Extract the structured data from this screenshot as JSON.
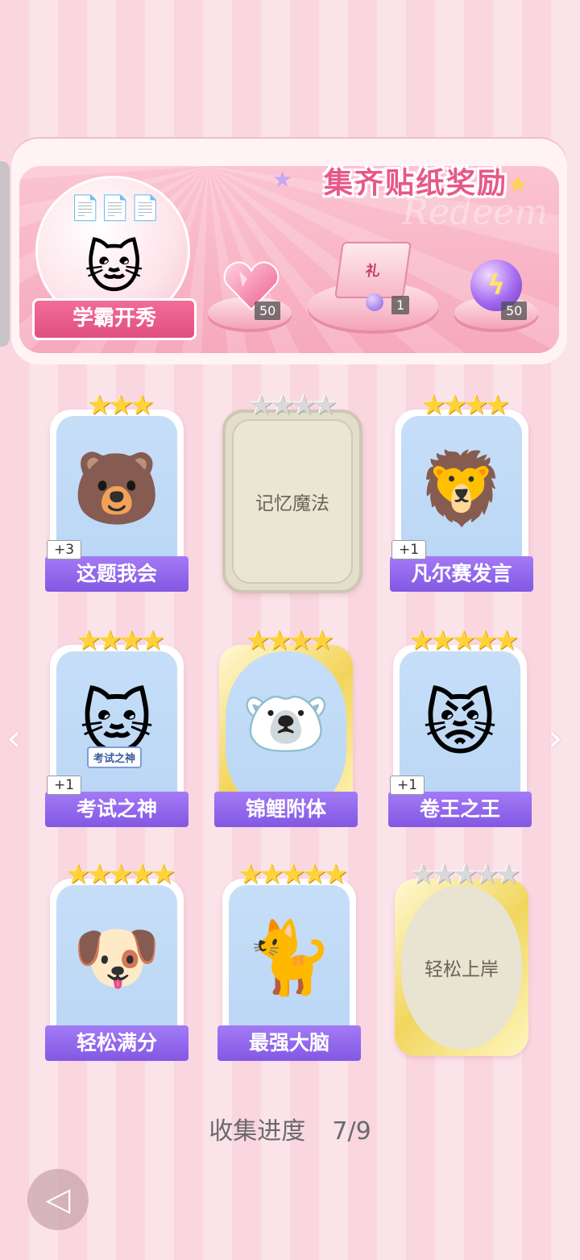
{
  "banner": {
    "title": "集齐贴纸奖励",
    "watermark": "Redeem",
    "sticker_name": "学霸开秀",
    "rewards": [
      {
        "icon": "heart-gem-icon",
        "count": "50"
      },
      {
        "icon": "gift-box-icon",
        "count": "1"
      },
      {
        "icon": "purple-orb-icon",
        "count": "50"
      }
    ]
  },
  "cards": [
    {
      "label": "这题我会",
      "stars_on": 3,
      "stars_total": 3,
      "plus": "+3",
      "state": "unlocked",
      "icon": "bear-at-desk-icon",
      "glyph": "🐻"
    },
    {
      "label": "记忆魔法",
      "stars_on": 0,
      "stars_total": 4,
      "plus": "",
      "state": "locked",
      "icon": "locked-card-icon",
      "glyph": ""
    },
    {
      "label": "凡尔赛发言",
      "stars_on": 4,
      "stars_total": 4,
      "plus": "+1",
      "state": "unlocked",
      "icon": "lion-microphone-icon",
      "glyph": "🦁"
    },
    {
      "label": "考试之神",
      "stars_on": 4,
      "stars_total": 4,
      "plus": "+1",
      "state": "unlocked",
      "icon": "angel-cat-icon",
      "glyph": "🐱",
      "sign": "考试之神"
    },
    {
      "label": "锦鲤附体",
      "stars_on": 4,
      "stars_total": 4,
      "plus": "",
      "state": "gold",
      "icon": "bear-koi-icon",
      "glyph": "🐻‍❄️"
    },
    {
      "label": "卷王之王",
      "stars_on": 5,
      "stars_total": 5,
      "plus": "+1",
      "state": "unlocked",
      "icon": "cat-studying-icon",
      "glyph": "😾"
    },
    {
      "label": "轻松满分",
      "stars_on": 5,
      "stars_total": 5,
      "plus": "",
      "state": "unlocked",
      "icon": "puppy-full-score-icon",
      "glyph": "🐶"
    },
    {
      "label": "最强大脑",
      "stars_on": 5,
      "stars_total": 5,
      "plus": "",
      "state": "unlocked",
      "icon": "cat-papers-icon",
      "glyph": "🐈"
    },
    {
      "label": "轻松上岸",
      "stars_on": 0,
      "stars_total": 5,
      "plus": "",
      "state": "oval-locked",
      "icon": "locked-oval-icon",
      "glyph": ""
    }
  ],
  "progress": {
    "label": "收集进度",
    "value": "7/9"
  }
}
